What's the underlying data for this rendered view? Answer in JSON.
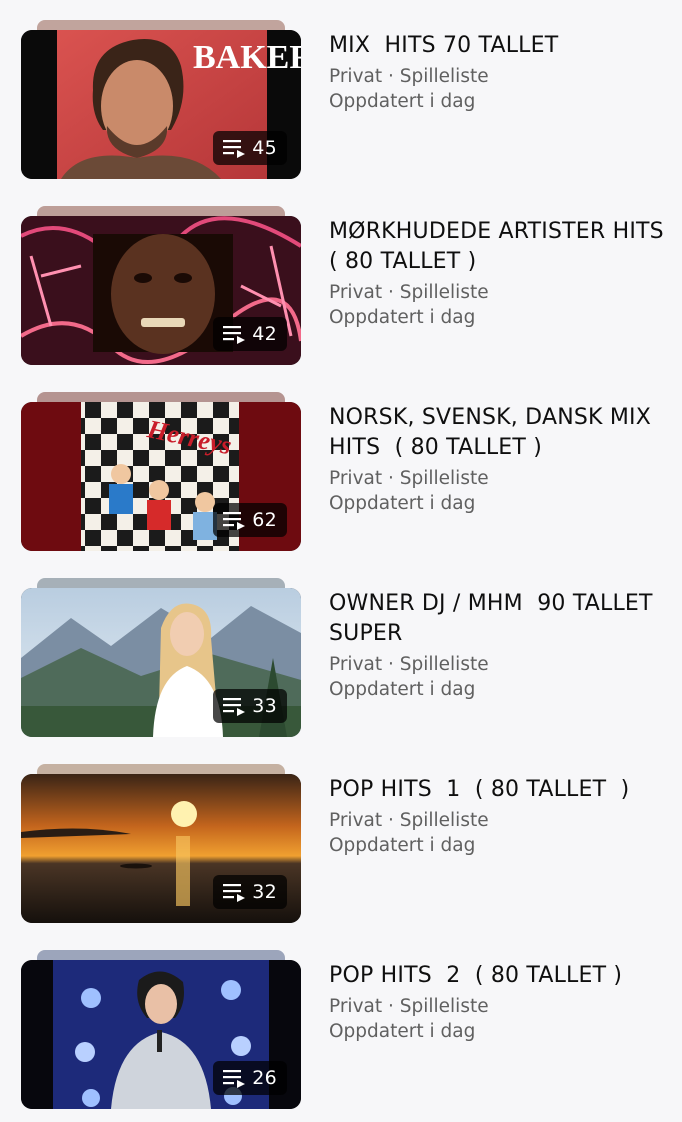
{
  "playlists": [
    {
      "title": "MIX  HITS 70 TALLET",
      "count": "45",
      "meta": "Privat · Spilleliste",
      "updated": "Oppdatert i dag",
      "accent": "#b7958d"
    },
    {
      "title": "MØRKHUDEDE ARTISTER HITS ( 80 TALLET )",
      "count": "42",
      "meta": "Privat · Spilleliste",
      "updated": "Oppdatert i dag",
      "accent": "#b38e87"
    },
    {
      "title": "NORSK, SVENSK, DANSK MIX HITS  ( 80 TALLET )",
      "count": "62",
      "meta": "Privat · Spilleliste",
      "updated": "Oppdatert i dag",
      "accent": "#a9837f"
    },
    {
      "title": "OWNER DJ / MHM  90 TALLET SUPER",
      "count": "33",
      "meta": "Privat · Spilleliste",
      "updated": "Oppdatert i dag",
      "accent": "#98a3ad"
    },
    {
      "title": "POP HITS  1  ( 80 TALLET  )",
      "count": "32",
      "meta": "Privat · Spilleliste",
      "updated": "Oppdatert i dag",
      "accent": "#bca593"
    },
    {
      "title": "POP HITS  2  ( 80 TALLET )",
      "count": "26",
      "meta": "Privat · Spilleliste",
      "updated": "Oppdatert i dag",
      "accent": "#8c97b0"
    }
  ],
  "thumb_text": {
    "baker": "BAKER",
    "herreys": "Herreys"
  },
  "badge_icon": "playlist-queue-icon"
}
